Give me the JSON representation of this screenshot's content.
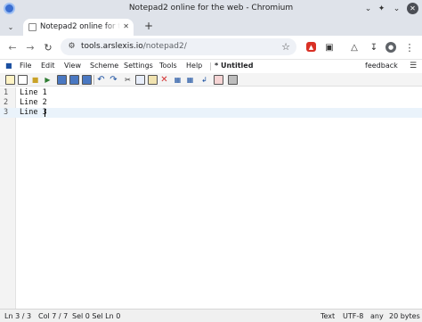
{
  "window": {
    "title": "Notepad2 online for the web - Chromium"
  },
  "tabs": [
    {
      "title": "Notepad2 online for the web"
    }
  ],
  "toolbar": {
    "url_host": "tools.arslexis.io",
    "url_path": "/notepad2/"
  },
  "menu": {
    "items": [
      "File",
      "Edit",
      "View",
      "Scheme",
      "Settings",
      "Tools",
      "Help"
    ],
    "document_title": "* Untitled",
    "feedback_label": "feedback"
  },
  "editor": {
    "lines": [
      {
        "num": "1",
        "text": "Line 1"
      },
      {
        "num": "2",
        "text": "Line 2"
      },
      {
        "num": "3",
        "text": "Line 3"
      }
    ]
  },
  "status": {
    "position": "Ln 3 / 3",
    "column": "Col 7 / 7",
    "selection": "Sel 0 Sel Ln 0",
    "mode": "Text",
    "encoding": "UTF-8",
    "line_ending": "any",
    "size": "20 bytes"
  },
  "colors": {
    "chrome_frame": "#dfe3ea",
    "current_line": "#eaf3fb",
    "accent": "#3b6fd1"
  }
}
